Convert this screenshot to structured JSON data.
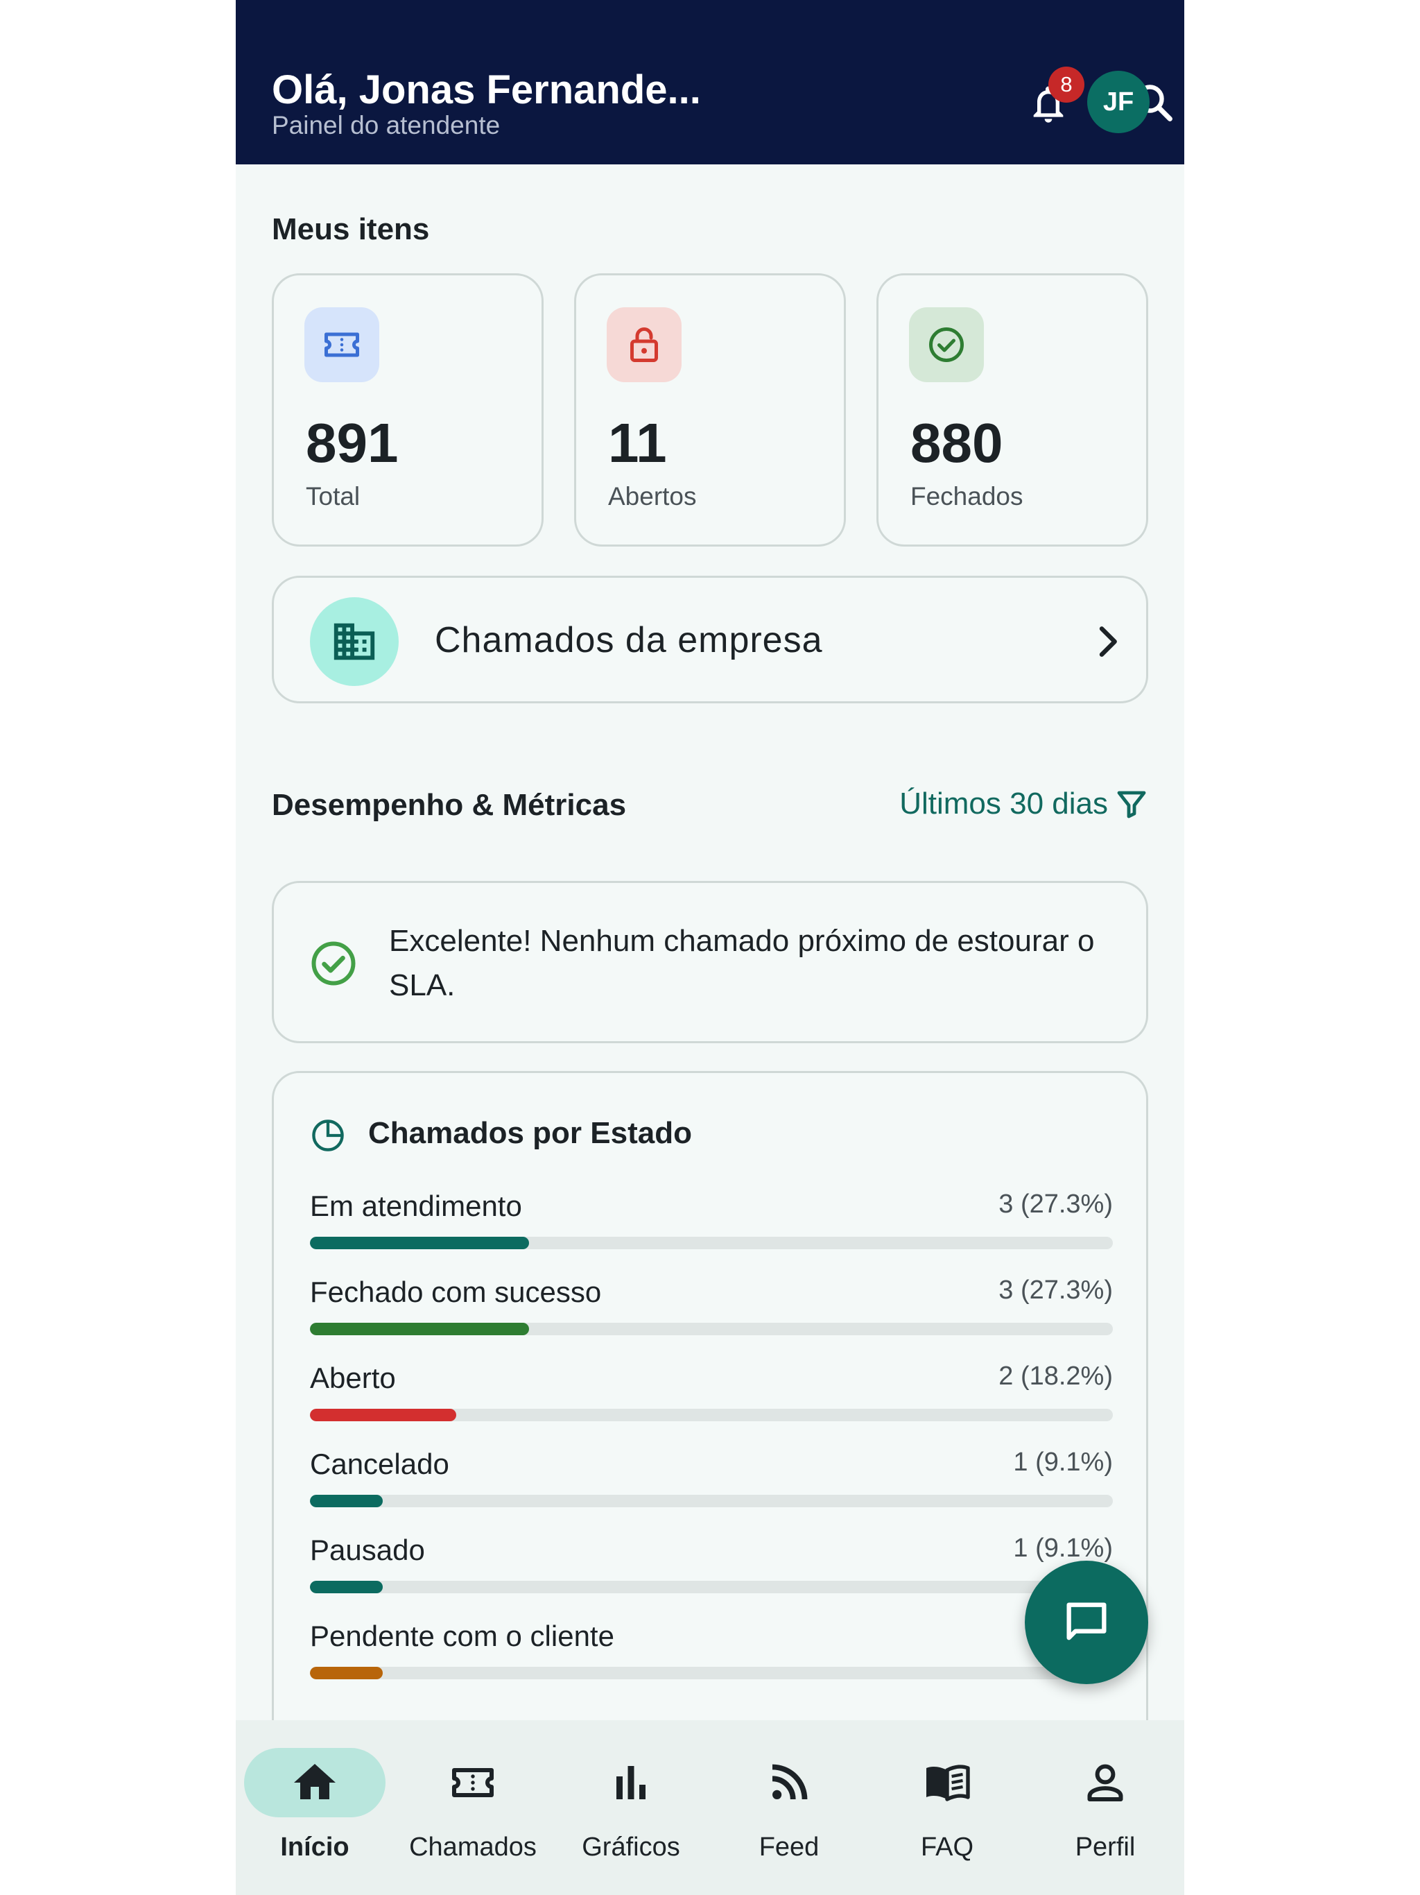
{
  "header": {
    "greeting": "Olá, Jonas Fernande...",
    "subtitle": "Painel do atendente",
    "notification_count": "8",
    "avatar_initials": "JF",
    "icons": [
      "bell-icon",
      "search-icon",
      "more-vertical-icon"
    ]
  },
  "my_items": {
    "title": "Meus itens",
    "cards": [
      {
        "value": "891",
        "label": "Total",
        "icon": "ticket-icon",
        "color": "#3b6fd4"
      },
      {
        "value": "11",
        "label": "Abertos",
        "icon": "unlock-icon",
        "color": "#d43a2f"
      },
      {
        "value": "880",
        "label": "Fechados",
        "icon": "check-circle-icon",
        "color": "#2e7d32"
      }
    ]
  },
  "company": {
    "label": "Chamados da empresa",
    "icon": "building-icon"
  },
  "metrics": {
    "title": "Desempenho & Métricas",
    "period_label": "Últimos 30 dias",
    "period_icon": "filter-icon"
  },
  "sla_alert": {
    "text": "Excelente! Nenhum chamado próximo de estourar o SLA."
  },
  "states": {
    "title": "Chamados por Estado",
    "items": [
      {
        "name": "Em atendimento",
        "count": "3 (27.3%)",
        "fraction": 0.273,
        "color": "#0c6b60"
      },
      {
        "name": "Fechado com sucesso",
        "count": "3 (27.3%)",
        "fraction": 0.273,
        "color": "#2e7d32"
      },
      {
        "name": "Aberto",
        "count": "2 (18.2%)",
        "fraction": 0.182,
        "color": "#d32f2f"
      },
      {
        "name": "Cancelado",
        "count": "1 (9.1%)",
        "fraction": 0.091,
        "color": "#0c6b60"
      },
      {
        "name": "Pausado",
        "count": "1 (9.1%)",
        "fraction": 0.091,
        "color": "#0c6b60"
      },
      {
        "name": "Pendente com o cliente",
        "count": "1",
        "fraction": 0.091,
        "color": "#b8650a"
      }
    ]
  },
  "fab": {
    "icon": "chat-icon"
  },
  "bottom_nav": {
    "items": [
      {
        "label": "Início",
        "icon": "home-icon",
        "active": true
      },
      {
        "label": "Chamados",
        "icon": "ticket-icon",
        "active": false
      },
      {
        "label": "Gráficos",
        "icon": "bar-chart-icon",
        "active": false
      },
      {
        "label": "Feed",
        "icon": "rss-icon",
        "active": false
      },
      {
        "label": "FAQ",
        "icon": "book-icon",
        "active": false
      },
      {
        "label": "Perfil",
        "icon": "person-icon",
        "active": false
      }
    ]
  }
}
